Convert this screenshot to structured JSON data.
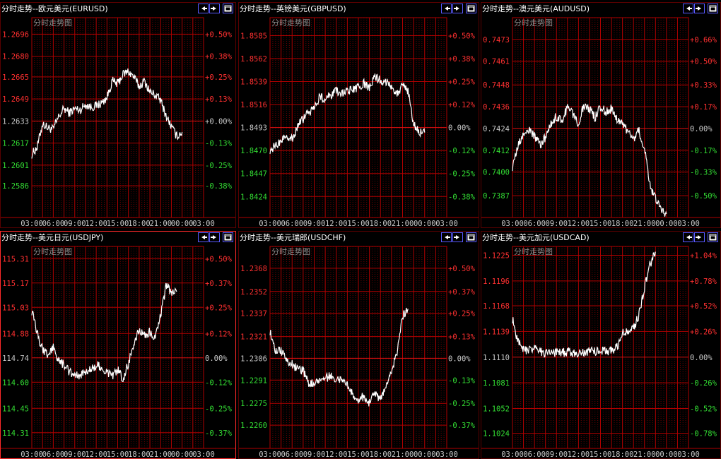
{
  "colors": {
    "background": "#000000",
    "grid_major": "#b00000",
    "grid_minor": "#6a0000",
    "price_up": "#ff3030",
    "price_down": "#33dd33",
    "neutral": "#c8c8c8",
    "line": "#ffffff",
    "button_border": "#5a5aff"
  },
  "icons": {
    "prev": "arrow-left-icon",
    "next": "arrow-right-icon",
    "maximize": "maximize-window-icon"
  },
  "panels": [
    {
      "title": "分时走势--欧元美元(EURUSD)",
      "subtitle": "分时走势图",
      "chart_data": {
        "type": "line",
        "symbol": "EURUSD",
        "base": 1.2633,
        "ylim": [
          1.2563,
          1.2708
        ],
        "y_ticks": [
          "1.2696",
          "1.2680",
          "1.2665",
          "1.2649",
          "1.2633",
          "1.2617",
          "1.2601",
          "1.2586"
        ],
        "pct_ticks": [
          "+0.50%",
          "+0.38%",
          "+0.25%",
          "+0.13%",
          "+0.00%",
          "-0.13%",
          "-0.25%",
          "-0.38%"
        ],
        "x_ticks": [
          "03:00",
          "06:00",
          "09:00",
          "12:00",
          "15:00",
          "18:00",
          "21:00",
          "00:00",
          "03:00"
        ],
        "series": [
          {
            "x": [
              0,
              0.5,
              1,
              1.5,
              2,
              2.5,
              3,
              3.5,
              4,
              4.5,
              5,
              5.5,
              6,
              6.5,
              7,
              7.5,
              8,
              8.5,
              9,
              9.5,
              10,
              10.5,
              11,
              11.5,
              12,
              12.5,
              13,
              13.5,
              14,
              14.5,
              15
            ],
            "y": [
              1.2609,
              1.2614,
              1.2631,
              1.2628,
              1.2627,
              1.2636,
              1.2642,
              1.2639,
              1.2642,
              1.2641,
              1.2645,
              1.2643,
              1.2644,
              1.2646,
              1.265,
              1.2662,
              1.266,
              1.2667,
              1.2669,
              1.2665,
              1.2658,
              1.2662,
              1.2654,
              1.2652,
              1.2648,
              1.2637,
              1.2629,
              1.2622,
              1.2625
            ]
          }
        ]
      }
    },
    {
      "title": "分时走势--英镑美元(GBPUSD)",
      "subtitle": "分时走势图",
      "chart_data": {
        "type": "line",
        "symbol": "GBPUSD",
        "base": 1.8493,
        "ylim": [
          1.8403,
          1.8603
        ],
        "y_ticks": [
          "1.8585",
          "1.8562",
          "1.8539",
          "1.8516",
          "1.8493",
          "1.8470",
          "1.8447",
          "1.8424"
        ],
        "pct_ticks": [
          "+0.50%",
          "+0.38%",
          "+0.25%",
          "+0.12%",
          "0.00%",
          "-0.12%",
          "-0.25%",
          "-0.38%"
        ],
        "x_ticks": [
          "03:00",
          "06:00",
          "09:00",
          "12:00",
          "15:00",
          "18:00",
          "21:00",
          "00:00",
          "03:00"
        ],
        "series": [
          {
            "x": [
              0,
              0.5,
              1,
              1.5,
              2,
              2.5,
              3,
              3.5,
              4,
              4.5,
              5,
              5.5,
              6,
              6.5,
              7,
              7.5,
              8,
              8.5,
              9,
              9.5,
              10,
              10.5,
              11,
              11.5,
              12,
              12.5,
              13,
              13.5,
              14,
              14.5,
              15
            ],
            "y": [
              1.8471,
              1.8474,
              1.848,
              1.8486,
              1.8481,
              1.8494,
              1.8502,
              1.8508,
              1.8513,
              1.8524,
              1.8521,
              1.8526,
              1.8529,
              1.8527,
              1.8531,
              1.853,
              1.8533,
              1.8537,
              1.8532,
              1.8544,
              1.854,
              1.8539,
              1.8535,
              1.8527,
              1.8535,
              1.853,
              1.8496,
              1.8488,
              1.8488
            ]
          }
        ]
      }
    },
    {
      "title": "分时走势--澳元美元(AUDUSD)",
      "subtitle": "分时走势图",
      "chart_data": {
        "type": "line",
        "symbol": "AUDUSD",
        "base": 0.7424,
        "ylim": [
          0.7375,
          0.7485
        ],
        "y_ticks": [
          "0.7473",
          "0.7461",
          "0.7448",
          "0.7436",
          "0.7424",
          "0.7412",
          "0.7400",
          "0.7387"
        ],
        "pct_ticks": [
          "+0.66%",
          "+0.50%",
          "+0.33%",
          "+0.17%",
          "0.00%",
          "-0.17%",
          "-0.33%",
          "-0.50%"
        ],
        "x_ticks": [
          "03:00",
          "06:00",
          "09:00",
          "12:00",
          "15:00",
          "18:00",
          "21:00",
          "00:00",
          "03:00"
        ],
        "series": [
          {
            "x": [
              0,
              0.5,
              1,
              1.5,
              2,
              2.5,
              3,
              3.5,
              4,
              4.5,
              5,
              5.5,
              6,
              6.5,
              7,
              7.5,
              8,
              8.5,
              9,
              9.5,
              10,
              10.5,
              11,
              11.5,
              12,
              12.5,
              13,
              13.5,
              14,
              14.5,
              15
            ],
            "y": [
              0.7403,
              0.7414,
              0.7421,
              0.7423,
              0.742,
              0.7415,
              0.7419,
              0.7426,
              0.7431,
              0.7428,
              0.7436,
              0.7432,
              0.7427,
              0.7437,
              0.7435,
              0.743,
              0.7436,
              0.7433,
              0.7435,
              0.7429,
              0.7427,
              0.7422,
              0.7418,
              0.7423,
              0.7413,
              0.7393,
              0.7385,
              0.738,
              0.7377
            ]
          }
        ]
      }
    },
    {
      "title": "分时走势--美元日元(USDJPY)",
      "subtitle": "分时走势图",
      "chart_data": {
        "type": "line",
        "symbol": "USDJPY",
        "base": 114.74,
        "ylim": [
          114.22,
          115.38
        ],
        "y_ticks": [
          "115.31",
          "115.17",
          "115.03",
          "114.88",
          "114.74",
          "114.60",
          "114.45",
          "114.31"
        ],
        "pct_ticks": [
          "+0.50%",
          "+0.37%",
          "+0.25%",
          "+0.12%",
          "0.00%",
          "-0.12%",
          "-0.25%",
          "-0.37%"
        ],
        "x_ticks": [
          "03:00",
          "06:00",
          "09:00",
          "12:00",
          "15:00",
          "18:00",
          "21:00",
          "00:00",
          "03:00"
        ],
        "series": [
          {
            "x": [
              0,
              0.5,
              1,
              1.5,
              2,
              2.5,
              3,
              3.5,
              4,
              4.5,
              5,
              5.5,
              6,
              6.5,
              7,
              7.5,
              8,
              8.5,
              9,
              9.5,
              10,
              10.5,
              11,
              11.5,
              12,
              12.5,
              13,
              13.5,
              14,
              14.5,
              15
            ],
            "y": [
              115.01,
              114.88,
              114.79,
              114.75,
              114.8,
              114.72,
              114.7,
              114.66,
              114.64,
              114.63,
              114.66,
              114.67,
              114.7,
              114.69,
              114.66,
              114.64,
              114.67,
              114.62,
              114.71,
              114.82,
              114.9,
              114.87,
              114.89,
              114.85,
              114.98,
              115.15,
              115.12,
              115.12
            ]
          }
        ]
      }
    },
    {
      "title": "分时走势--美元瑞郎(USDCHF)",
      "subtitle": "分时走势图",
      "chart_data": {
        "type": "line",
        "symbol": "USDCHF",
        "base": 1.2306,
        "ylim": [
          1.2244,
          1.2383
        ],
        "y_ticks": [
          "1.2368",
          "1.2352",
          "1.2337",
          "1.2321",
          "1.2306",
          "1.2291",
          "1.2275",
          "1.2260"
        ],
        "pct_ticks": [
          "+0.50%",
          "+0.37%",
          "+0.25%",
          "+0.13%",
          "0.00%",
          "-0.13%",
          "-0.25%",
          "-0.37%"
        ],
        "x_ticks": [
          "03:00",
          "06:00",
          "09:00",
          "12:00",
          "15:00",
          "18:00",
          "21:00",
          "00:00",
          "03:00"
        ],
        "series": [
          {
            "x": [
              0,
              0.5,
              1,
              1.5,
              2,
              2.5,
              3,
              3.5,
              4,
              4.5,
              5,
              5.5,
              6,
              6.5,
              7,
              7.5,
              8,
              8.5,
              9,
              9.5,
              10,
              10.5,
              11,
              11.5,
              12,
              12.5,
              13,
              13.5,
              14,
              14.5,
              15
            ],
            "y": [
              1.2325,
              1.231,
              1.2312,
              1.2305,
              1.2302,
              1.2298,
              1.2297,
              1.2289,
              1.2288,
              1.2292,
              1.2292,
              1.2294,
              1.2292,
              1.229,
              1.2287,
              1.2282,
              1.2277,
              1.228,
              1.2275,
              1.2282,
              1.2278,
              1.2287,
              1.2297,
              1.231,
              1.2335,
              1.234
            ]
          }
        ]
      }
    },
    {
      "title": "分时走势--美元加元(USDCAD)",
      "subtitle": "分时走势图",
      "chart_data": {
        "type": "line",
        "symbol": "USDCAD",
        "base": 1.111,
        "ylim": [
          1.1007,
          1.1235
        ],
        "y_ticks": [
          "1.1225",
          "1.1196",
          "1.1168",
          "1.1139",
          "1.1110",
          "1.1081",
          "1.1052",
          "1.1024"
        ],
        "pct_ticks": [
          "+1.04%",
          "+0.78%",
          "+0.52%",
          "+0.26%",
          "0.00%",
          "-0.26%",
          "-0.52%",
          "-0.78%"
        ],
        "x_ticks": [
          "03:00",
          "06:00",
          "09:00",
          "12:00",
          "15:00",
          "18:00",
          "21:00",
          "00:00",
          "03:00"
        ],
        "series": [
          {
            "x": [
              0,
              0.5,
              1,
              1.5,
              2,
              2.5,
              3,
              3.5,
              4,
              4.5,
              5,
              5.5,
              6,
              6.5,
              7,
              7.5,
              8,
              8.5,
              9,
              9.5,
              10,
              10.5,
              11,
              11.5,
              12,
              12.5,
              13,
              13.5,
              14,
              14.5,
              15
            ],
            "y": [
              1.1153,
              1.1127,
              1.1118,
              1.1117,
              1.1119,
              1.1116,
              1.1115,
              1.1114,
              1.1115,
              1.1115,
              1.1116,
              1.1115,
              1.1114,
              1.1116,
              1.1116,
              1.1117,
              1.1118,
              1.1116,
              1.1118,
              1.1121,
              1.1138,
              1.1139,
              1.1142,
              1.1158,
              1.1188,
              1.1214,
              1.1229
            ]
          }
        ]
      }
    }
  ]
}
